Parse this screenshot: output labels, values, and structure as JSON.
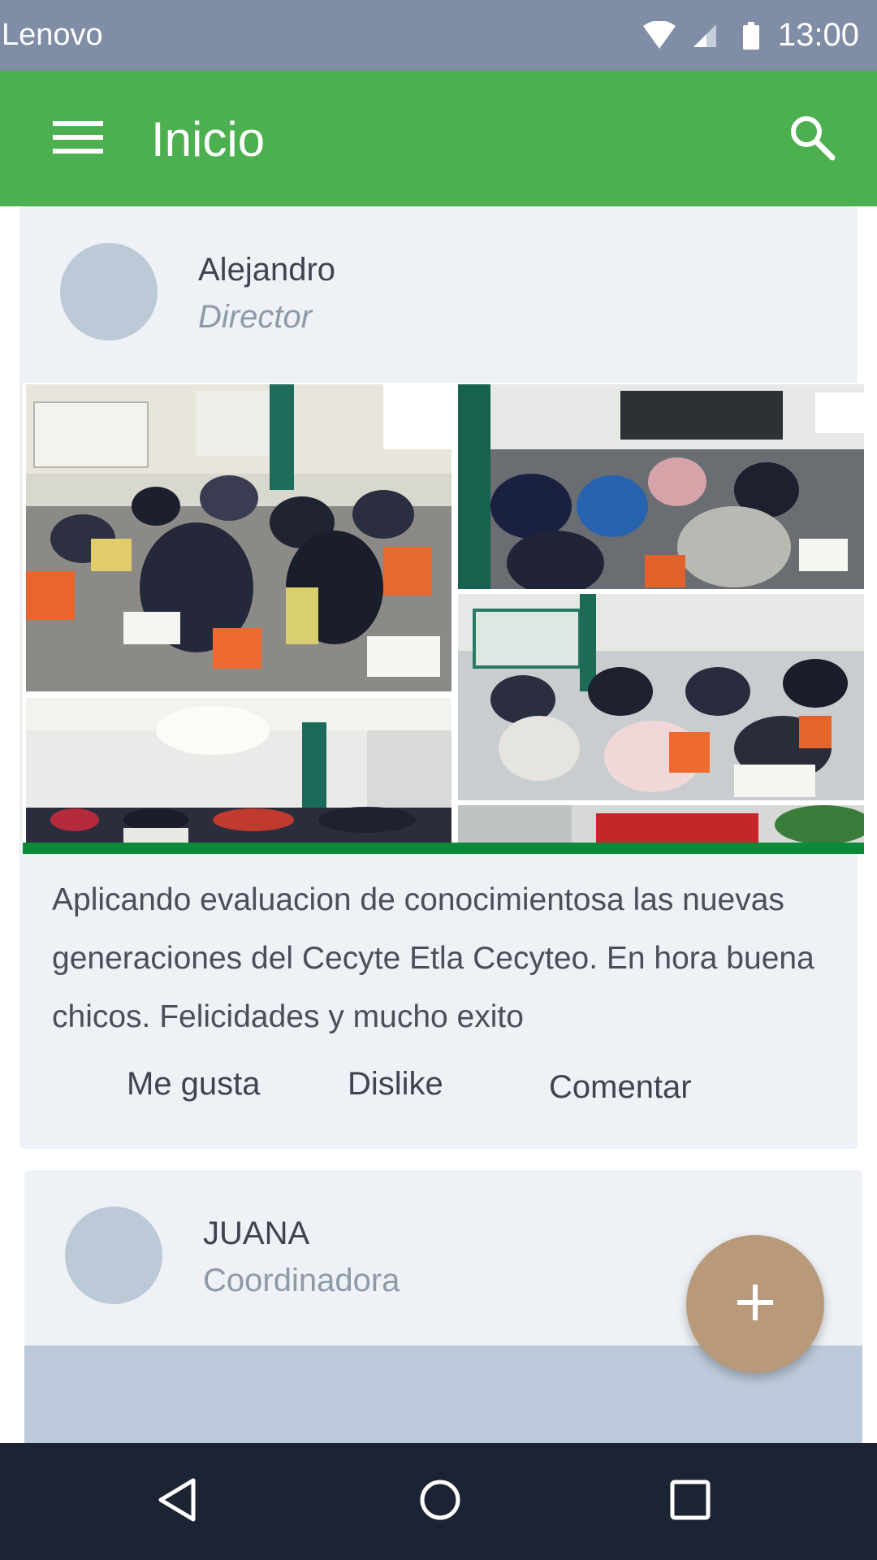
{
  "status_bar": {
    "carrier": "Lenovo",
    "time": "13:00",
    "icons": [
      "wifi-icon",
      "signal-icon",
      "battery-icon"
    ]
  },
  "app_bar": {
    "title": "Inicio",
    "menu_icon": "menu-icon",
    "search_icon": "search-icon",
    "color": "#4caf50"
  },
  "feed": {
    "posts": [
      {
        "author": "Alejandro",
        "role": "Director",
        "text": "Aplicando evaluacion de conocimientosa las nuevas generaciones del Cecyte Etla Cecyteo. En hora buena chicos. Felicidades y mucho exito",
        "actions": {
          "like": "Me gusta",
          "dislike": "Dislike",
          "comment": "Comentar"
        }
      },
      {
        "author": "JUANA",
        "role": "Coordinadora"
      }
    ]
  },
  "fab": {
    "icon": "plus-icon",
    "color": "#b89a7b"
  },
  "nav_bar": {
    "icons": [
      "back-icon",
      "home-icon",
      "recents-icon"
    ]
  }
}
